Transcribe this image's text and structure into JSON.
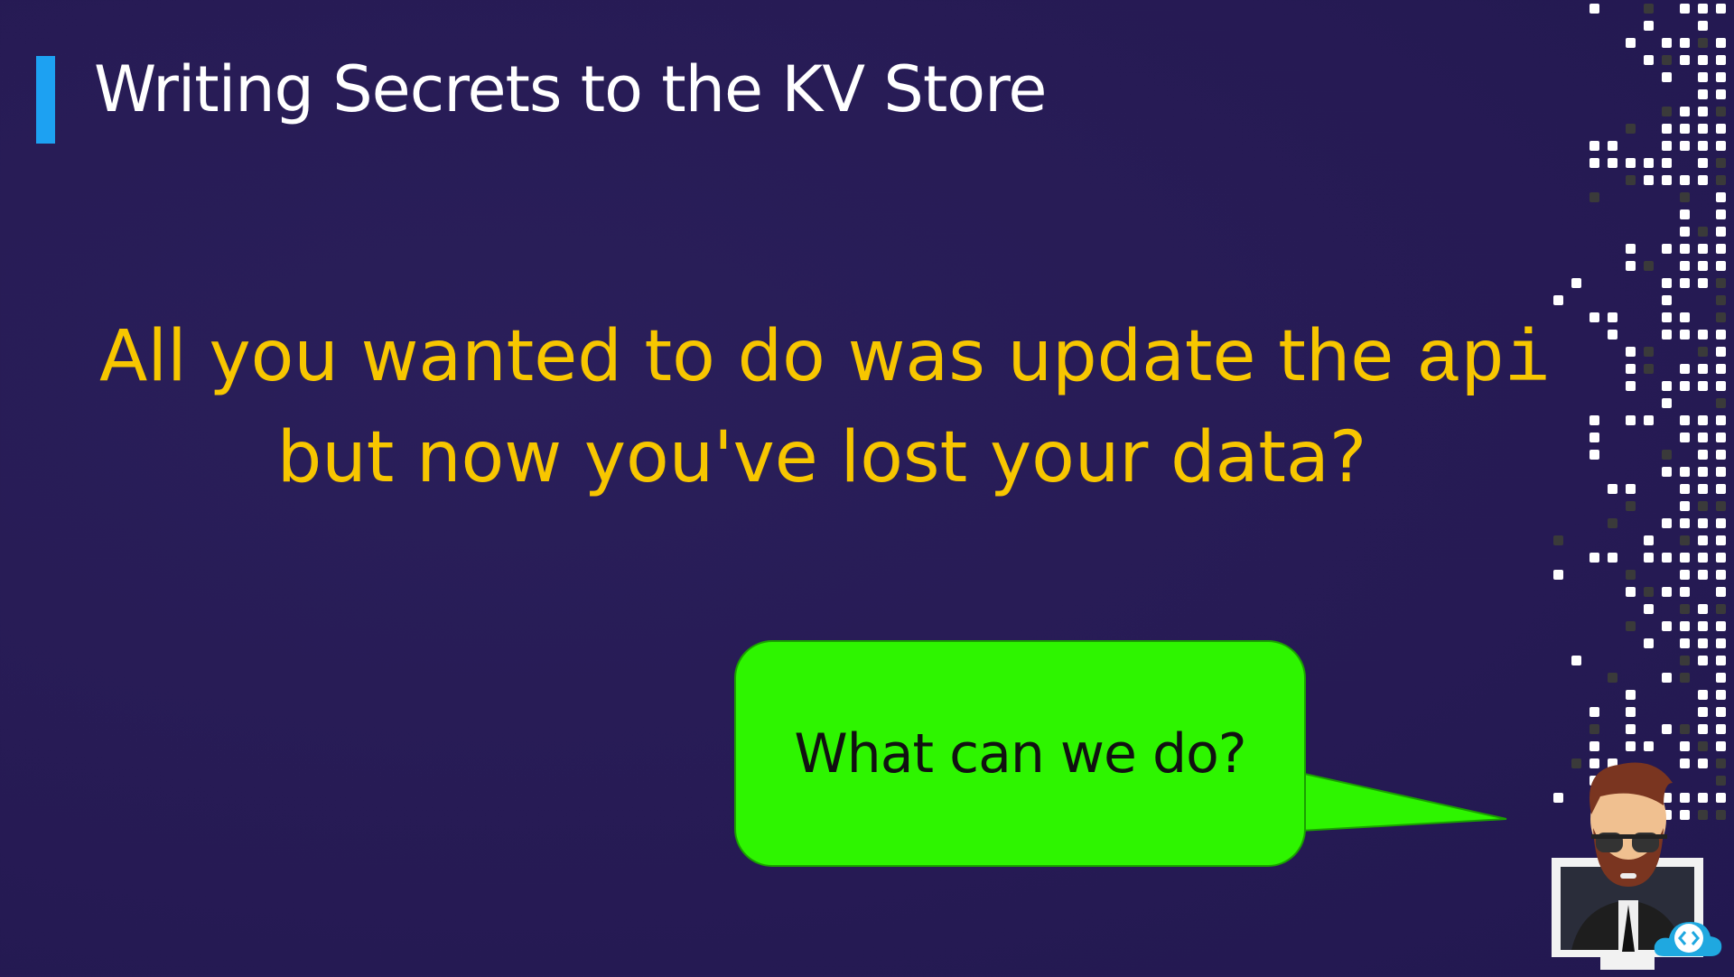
{
  "slide": {
    "title": "Writing Secrets to the KV Store",
    "line1_text": "All you wanted to do was update the ",
    "line1_code": "api",
    "line2_text": "but now you've lost your data?",
    "bubble_text": "What can we do?"
  },
  "colors": {
    "background": "#271b55",
    "accent": "#1da1f2",
    "highlight_text": "#f7c600",
    "bubble": "#2ef500"
  },
  "icons": [
    "presenter-avatar",
    "cloud-code-logo",
    "pixel-dot-pattern"
  ]
}
